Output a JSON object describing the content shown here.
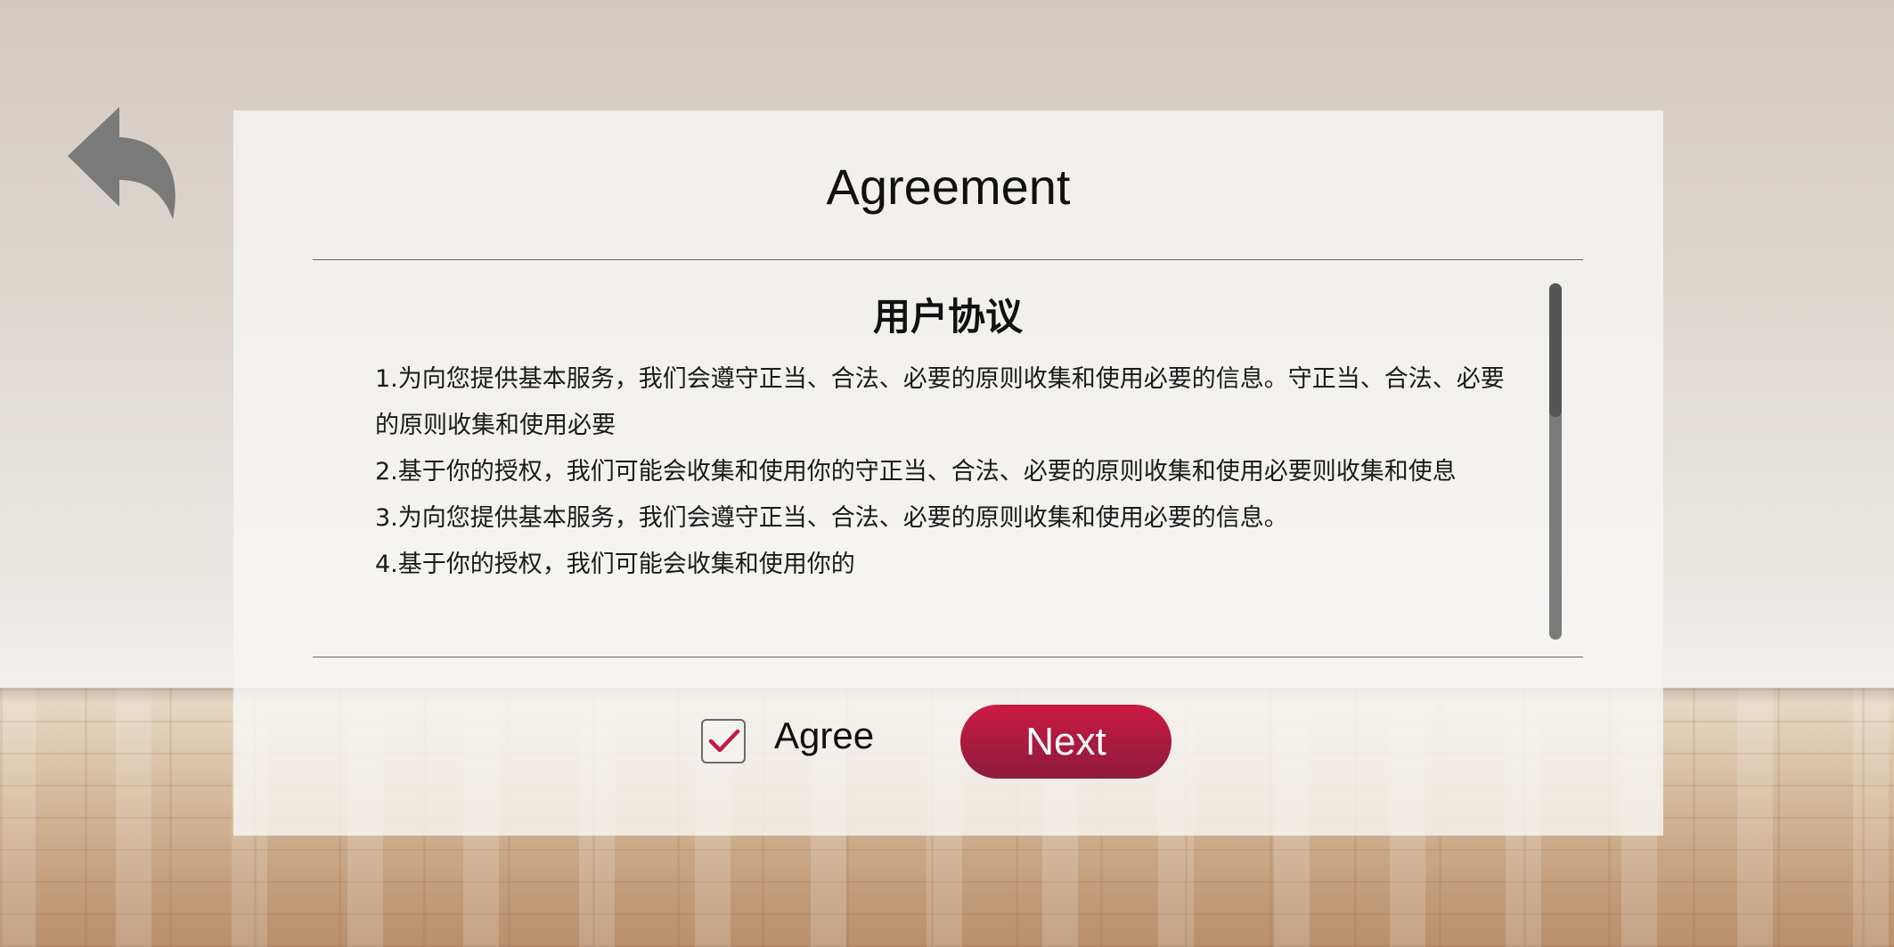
{
  "dialog": {
    "title": "Agreement",
    "heading": "用户协议",
    "paragraphs": [
      "1.为向您提供基本服务，我们会遵守正当、合法、必要的原则收集和使用必要的信息。守正当、合法、必要的原则收集和使用必要",
      "2.基于你的授权，我们可能会收集和使用你的守正当、合法、必要的原则收集和使用必要则收集和使息",
      "3.为向您提供基本服务，我们会遵守正当、合法、必要的原则收集和使用必要的信息。",
      "4.基于你的授权，我们可能会收集和使用你的"
    ]
  },
  "controls": {
    "agree_label": "Agree",
    "agree_checked": true,
    "next_label": "Next"
  },
  "icons": {
    "back": "back-arrow-icon",
    "check": "checkmark-icon"
  },
  "colors": {
    "accent": "#c01a40",
    "icon_gray": "#7a7a7a"
  }
}
